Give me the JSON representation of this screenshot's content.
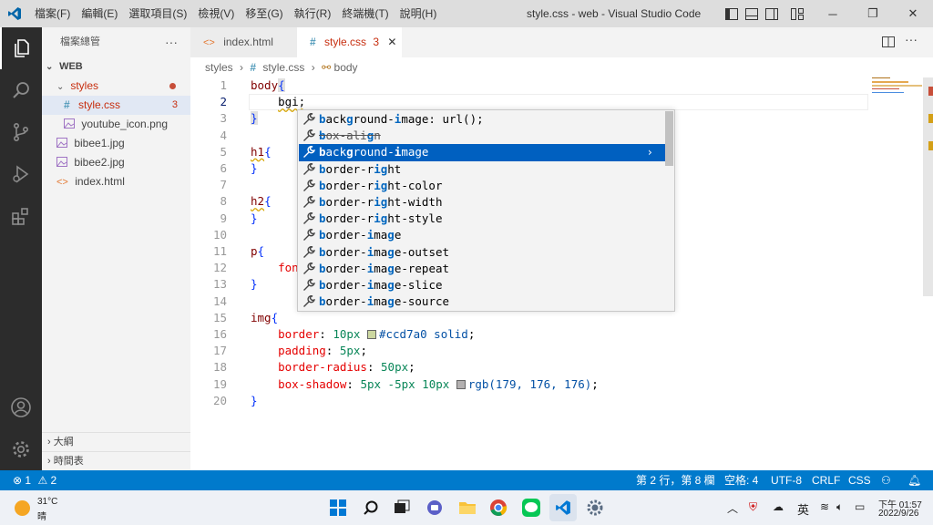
{
  "window": {
    "menu": [
      "檔案(F)",
      "編輯(E)",
      "選取項目(S)",
      "檢視(V)",
      "移至(G)",
      "執行(R)",
      "終端機(T)",
      "說明(H)"
    ],
    "title": "style.css - web - Visual Studio Code"
  },
  "sidebar": {
    "header": "檔案總管",
    "more": "···",
    "folder": "WEB",
    "tree": [
      {
        "label": "styles",
        "type": "folder"
      },
      {
        "label": "style.css",
        "type": "css",
        "badge": "3"
      },
      {
        "label": "youtube_icon.png",
        "type": "image"
      },
      {
        "label": "bibee1.jpg",
        "type": "image"
      },
      {
        "label": "bibee2.jpg",
        "type": "image"
      },
      {
        "label": "index.html",
        "type": "html"
      }
    ],
    "outline": "大綱",
    "timeline": "時間表"
  },
  "tabs": [
    {
      "label": "index.html",
      "active": false
    },
    {
      "label": "style.css",
      "badge": "3",
      "active": true
    }
  ],
  "breadcrumb": {
    "folder": "styles",
    "file": "style.css",
    "symbol": "body"
  },
  "editor": {
    "lines": [
      "1",
      "2",
      "3",
      "4",
      "5",
      "6",
      "7",
      "8",
      "9",
      "10",
      "11",
      "12",
      "13",
      "14",
      "15",
      "16",
      "17",
      "18",
      "19",
      "20"
    ],
    "code": {
      "l1_sel": "body",
      "l1_brace": "{",
      "l2": "bgi;",
      "l5_sel": "h1",
      "l8_sel": "h2",
      "l11_sel": "p",
      "l12": "fon",
      "l15_sel": "img",
      "l16_prop": "border",
      "l16_num": "10px",
      "l16_val": "#ccd7a0 solid",
      "l17_prop": "padding",
      "l17_num": "5px",
      "l18_prop": "border-radius",
      "l18_num": "50px",
      "l19_prop": "box-shadow",
      "l19_num": "5px -5px 10px",
      "l19_val": "rgb(179, 176, 176)",
      "open": "{",
      "close": "}",
      "colon": ": ",
      "semi": ";"
    }
  },
  "suggest": {
    "items": [
      {
        "pre": "",
        "b1": "b",
        "mid1": "ack",
        "b2": "g",
        "mid2": "round-",
        "b3": "i",
        "post": "mage: url();"
      },
      {
        "pre": "",
        "b1": "b",
        "mid1": "ox-ali",
        "b2": "g",
        "mid2": "n",
        "b3": "",
        "post": ""
      },
      {
        "pre": "",
        "b1": "b",
        "mid1": "ack",
        "b2": "g",
        "mid2": "round-",
        "b3": "i",
        "post": "mage"
      },
      {
        "pre": "",
        "b1": "b",
        "mid1": "order-r",
        "b2": "ig",
        "mid2": "ht",
        "b3": "",
        "post": ""
      },
      {
        "pre": "",
        "b1": "b",
        "mid1": "order-r",
        "b2": "ig",
        "mid2": "ht-color",
        "b3": "",
        "post": ""
      },
      {
        "pre": "",
        "b1": "b",
        "mid1": "order-r",
        "b2": "ig",
        "mid2": "ht-width",
        "b3": "",
        "post": ""
      },
      {
        "pre": "",
        "b1": "b",
        "mid1": "order-r",
        "b2": "ig",
        "mid2": "ht-style",
        "b3": "",
        "post": ""
      },
      {
        "pre": "",
        "b1": "b",
        "mid1": "order-",
        "b2": "i",
        "mid2": "ma",
        "b3": "g",
        "post": "e"
      },
      {
        "pre": "",
        "b1": "b",
        "mid1": "order-",
        "b2": "i",
        "mid2": "ma",
        "b3": "g",
        "post": "e-outset"
      },
      {
        "pre": "",
        "b1": "b",
        "mid1": "order-",
        "b2": "i",
        "mid2": "ma",
        "b3": "g",
        "post": "e-repeat"
      },
      {
        "pre": "",
        "b1": "b",
        "mid1": "order-",
        "b2": "i",
        "mid2": "ma",
        "b3": "g",
        "post": "e-slice"
      },
      {
        "pre": "",
        "b1": "b",
        "mid1": "order-",
        "b2": "i",
        "mid2": "ma",
        "b3": "g",
        "post": "e-source"
      }
    ],
    "focused_arrow": "›"
  },
  "status": {
    "errors": "1",
    "warnings": "2",
    "position": "第 2 行，第 8 欄",
    "spaces": "空格: 4",
    "encoding": "UTF-8",
    "eol": "CRLF",
    "language": "CSS"
  },
  "taskbar": {
    "temp": "31°C",
    "weather": "晴",
    "ime": "英",
    "time": "下午 01:57",
    "date": "2022/9/26"
  },
  "colors": {
    "accent": "#007acc",
    "swatch1": "#ccd7a0",
    "swatch2": "#b3b0b0",
    "focus_row": "#0060c0"
  }
}
